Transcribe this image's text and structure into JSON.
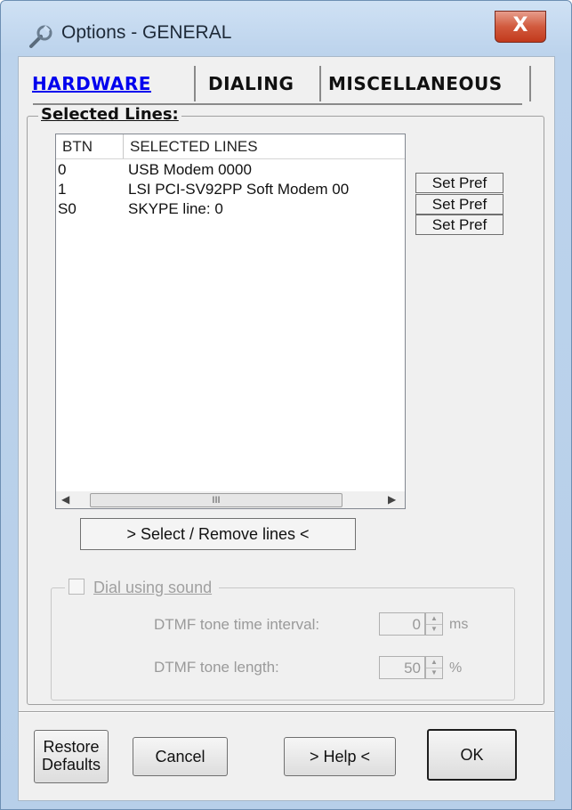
{
  "window": {
    "title": "Options - GENERAL",
    "close_glyph": "X",
    "icon": "wrench-icon"
  },
  "tabs": [
    {
      "label": "HARDWARE",
      "active": true
    },
    {
      "label": "DIALING",
      "active": false
    },
    {
      "label": "MISCELLANEOUS",
      "active": false
    }
  ],
  "selected_lines": {
    "caption": "Selected Lines:",
    "columns": [
      "BTN",
      "SELECTED LINES"
    ],
    "rows": [
      {
        "btn": "0",
        "line": "USB Modem 0000"
      },
      {
        "btn": "1",
        "line": "LSI PCI-SV92PP Soft Modem 00"
      },
      {
        "btn": "S0",
        "line": "SKYPE line: 0"
      }
    ],
    "set_pref_label": "Set Pref",
    "scroll_thumb_glyph": "III",
    "select_remove_label": "> Select / Remove lines <"
  },
  "dial_sound": {
    "label": "Dial using sound",
    "checked": false,
    "tone_interval_label": "DTMF tone time interval:",
    "tone_interval_value": "0",
    "tone_interval_unit": "ms",
    "tone_length_label": "DTMF tone length:",
    "tone_length_value": "50",
    "tone_length_unit": "%"
  },
  "buttons": {
    "restore_line1": "Restore",
    "restore_line2": "Defaults",
    "cancel": "Cancel",
    "help": "> Help <",
    "ok": "OK"
  }
}
